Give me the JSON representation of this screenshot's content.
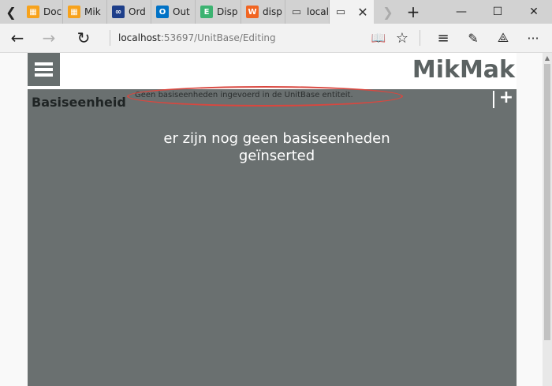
{
  "browser": {
    "tabs": [
      {
        "label": "Doc",
        "icon": "office-orange-icon",
        "color": "#f7a21b"
      },
      {
        "label": "Mik",
        "icon": "office-orange-icon",
        "color": "#f7a21b"
      },
      {
        "label": "Ord",
        "icon": "visual-studio-icon",
        "color": "#1e3f8a"
      },
      {
        "label": "Out",
        "icon": "outlook-icon",
        "color": "#0072c6"
      },
      {
        "label": "Disp",
        "icon": "green-e-icon",
        "color": "#3cb371"
      },
      {
        "label": "disp",
        "icon": "w-orange-icon",
        "color": "#f16522"
      },
      {
        "label": "local",
        "icon": "page-icon",
        "color": "#555555",
        "active": true
      }
    ],
    "address": {
      "host": "localhost",
      "rest": ":53697/UnitBase/Editing"
    }
  },
  "page": {
    "brand": "MikMak",
    "panel": {
      "title": "Basiseenheid",
      "message": "Geen basiseenheden ingevoerd in de UnitBase entiteit.",
      "empty_line1": "er zijn nog geen basiseenheden",
      "empty_line2": "geïnserted",
      "add_label": "+"
    }
  },
  "colors": {
    "header_accent": "#676e6e",
    "panel_bg": "#6a7070",
    "highlight": "#d9473f"
  }
}
